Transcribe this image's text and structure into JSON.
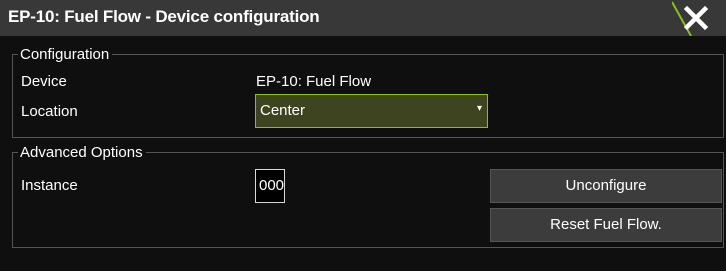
{
  "window": {
    "title": "EP-10: Fuel Flow - Device configuration",
    "close_icon": "close-x-icon",
    "accent_color": "#8bbf1e"
  },
  "configuration": {
    "group_label": "Configuration",
    "device_label": "Device",
    "device_value": "EP-10: Fuel Flow",
    "location_label": "Location",
    "location_value": "Center"
  },
  "advanced": {
    "group_label": "Advanced Options",
    "instance_label": "Instance",
    "instance_value": "000",
    "unconfigure_label": "Unconfigure",
    "reset_label": "Reset Fuel Flow."
  }
}
